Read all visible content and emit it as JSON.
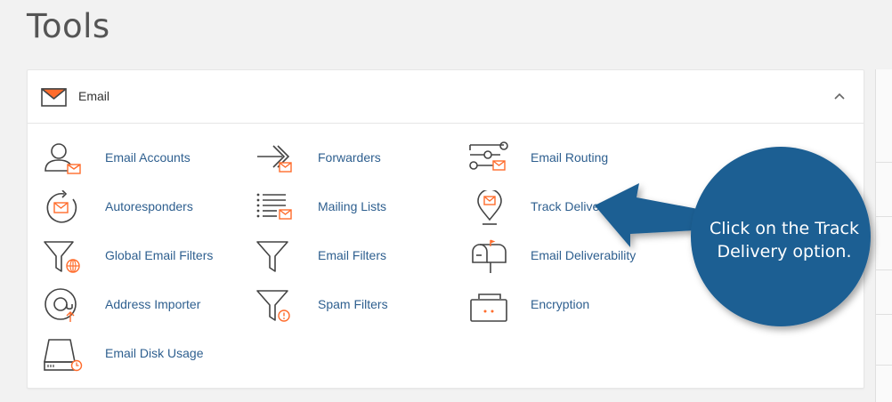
{
  "page": {
    "title": "Tools"
  },
  "email_panel": {
    "title": "Email",
    "items": [
      {
        "label": "Email Accounts",
        "icon": "email-accounts-icon"
      },
      {
        "label": "Forwarders",
        "icon": "forwarders-icon"
      },
      {
        "label": "Email Routing",
        "icon": "email-routing-icon"
      },
      {
        "label": "Autoresponders",
        "icon": "autoresponders-icon"
      },
      {
        "label": "Mailing Lists",
        "icon": "mailing-lists-icon"
      },
      {
        "label": "Track Delivery",
        "icon": "track-delivery-icon"
      },
      {
        "label": "Global Email Filters",
        "icon": "global-email-filters-icon"
      },
      {
        "label": "Email Filters",
        "icon": "email-filters-icon"
      },
      {
        "label": "Email Deliverability",
        "icon": "email-deliverability-icon"
      },
      {
        "label": "Address Importer",
        "icon": "address-importer-icon"
      },
      {
        "label": "Spam Filters",
        "icon": "spam-filters-icon"
      },
      {
        "label": "Encryption",
        "icon": "encryption-icon"
      },
      {
        "label": "Email Disk Usage",
        "icon": "email-disk-usage-icon"
      }
    ]
  },
  "callout": {
    "text": "Click on the Track Delivery option."
  },
  "colors": {
    "accent": "#ff6c2c",
    "link": "#2e5f8f",
    "callout_fill": "#1f5f93",
    "icon_stroke": "#444444"
  }
}
